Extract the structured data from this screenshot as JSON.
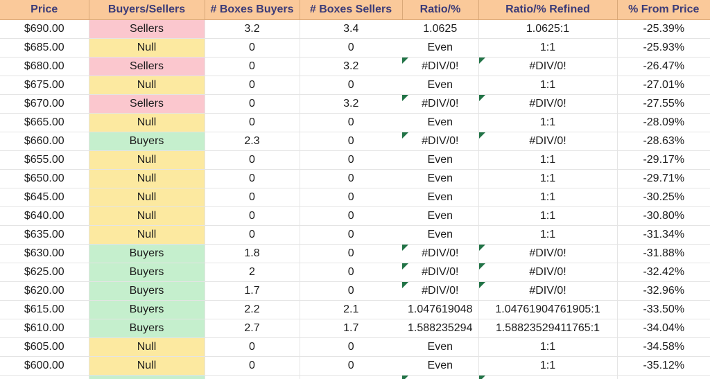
{
  "table": {
    "columns": [
      {
        "key": "price",
        "label": "Price"
      },
      {
        "key": "bs",
        "label": "Buyers/Sellers"
      },
      {
        "key": "boxes_buy",
        "label": "# Boxes Buyers"
      },
      {
        "key": "boxes_sell",
        "label": "# Boxes Sellers"
      },
      {
        "key": "ratio",
        "label": "Ratio/%"
      },
      {
        "key": "ratio_ref",
        "label": "Ratio/% Refined"
      },
      {
        "key": "pct",
        "label": "% From Price"
      }
    ],
    "colors": {
      "header_bg": "#fac99a",
      "header_text": "#3b3b78",
      "sellers_bg": "#fbc7ce",
      "sellers_text": "#cc2f45",
      "null_bg": "#fce9a0",
      "null_text": "#b8860b",
      "buyers_bg": "#c5efcd",
      "buyers_text": "#1b7a32",
      "error_flag": "#217346",
      "gridline": "#e4e4e4",
      "cell_text": "#1d1d1d"
    },
    "rows": [
      {
        "price": "$690.00",
        "bs": "Sellers",
        "status": "sellers",
        "boxes_buy": "3.2",
        "boxes_sell": "3.4",
        "ratio": "1.0625",
        "ratio_flag": false,
        "ratio_ref": "1.0625:1",
        "ratio_ref_flag": false,
        "pct": "-25.39%"
      },
      {
        "price": "$685.00",
        "bs": "Null",
        "status": "null",
        "boxes_buy": "0",
        "boxes_sell": "0",
        "ratio": "Even",
        "ratio_flag": false,
        "ratio_ref": "1:1",
        "ratio_ref_flag": false,
        "pct": "-25.93%"
      },
      {
        "price": "$680.00",
        "bs": "Sellers",
        "status": "sellers",
        "boxes_buy": "0",
        "boxes_sell": "3.2",
        "ratio": "#DIV/0!",
        "ratio_flag": true,
        "ratio_ref": "#DIV/0!",
        "ratio_ref_flag": true,
        "pct": "-26.47%"
      },
      {
        "price": "$675.00",
        "bs": "Null",
        "status": "null",
        "boxes_buy": "0",
        "boxes_sell": "0",
        "ratio": "Even",
        "ratio_flag": false,
        "ratio_ref": "1:1",
        "ratio_ref_flag": false,
        "pct": "-27.01%"
      },
      {
        "price": "$670.00",
        "bs": "Sellers",
        "status": "sellers",
        "boxes_buy": "0",
        "boxes_sell": "3.2",
        "ratio": "#DIV/0!",
        "ratio_flag": true,
        "ratio_ref": "#DIV/0!",
        "ratio_ref_flag": true,
        "pct": "-27.55%"
      },
      {
        "price": "$665.00",
        "bs": "Null",
        "status": "null",
        "boxes_buy": "0",
        "boxes_sell": "0",
        "ratio": "Even",
        "ratio_flag": false,
        "ratio_ref": "1:1",
        "ratio_ref_flag": false,
        "pct": "-28.09%"
      },
      {
        "price": "$660.00",
        "bs": "Buyers",
        "status": "buyers",
        "boxes_buy": "2.3",
        "boxes_sell": "0",
        "ratio": "#DIV/0!",
        "ratio_flag": true,
        "ratio_ref": "#DIV/0!",
        "ratio_ref_flag": true,
        "pct": "-28.63%"
      },
      {
        "price": "$655.00",
        "bs": "Null",
        "status": "null",
        "boxes_buy": "0",
        "boxes_sell": "0",
        "ratio": "Even",
        "ratio_flag": false,
        "ratio_ref": "1:1",
        "ratio_ref_flag": false,
        "pct": "-29.17%"
      },
      {
        "price": "$650.00",
        "bs": "Null",
        "status": "null",
        "boxes_buy": "0",
        "boxes_sell": "0",
        "ratio": "Even",
        "ratio_flag": false,
        "ratio_ref": "1:1",
        "ratio_ref_flag": false,
        "pct": "-29.71%"
      },
      {
        "price": "$645.00",
        "bs": "Null",
        "status": "null",
        "boxes_buy": "0",
        "boxes_sell": "0",
        "ratio": "Even",
        "ratio_flag": false,
        "ratio_ref": "1:1",
        "ratio_ref_flag": false,
        "pct": "-30.25%"
      },
      {
        "price": "$640.00",
        "bs": "Null",
        "status": "null",
        "boxes_buy": "0",
        "boxes_sell": "0",
        "ratio": "Even",
        "ratio_flag": false,
        "ratio_ref": "1:1",
        "ratio_ref_flag": false,
        "pct": "-30.80%"
      },
      {
        "price": "$635.00",
        "bs": "Null",
        "status": "null",
        "boxes_buy": "0",
        "boxes_sell": "0",
        "ratio": "Even",
        "ratio_flag": false,
        "ratio_ref": "1:1",
        "ratio_ref_flag": false,
        "pct": "-31.34%"
      },
      {
        "price": "$630.00",
        "bs": "Buyers",
        "status": "buyers",
        "boxes_buy": "1.8",
        "boxes_sell": "0",
        "ratio": "#DIV/0!",
        "ratio_flag": true,
        "ratio_ref": "#DIV/0!",
        "ratio_ref_flag": true,
        "pct": "-31.88%"
      },
      {
        "price": "$625.00",
        "bs": "Buyers",
        "status": "buyers",
        "boxes_buy": "2",
        "boxes_sell": "0",
        "ratio": "#DIV/0!",
        "ratio_flag": true,
        "ratio_ref": "#DIV/0!",
        "ratio_ref_flag": true,
        "pct": "-32.42%"
      },
      {
        "price": "$620.00",
        "bs": "Buyers",
        "status": "buyers",
        "boxes_buy": "1.7",
        "boxes_sell": "0",
        "ratio": "#DIV/0!",
        "ratio_flag": true,
        "ratio_ref": "#DIV/0!",
        "ratio_ref_flag": true,
        "pct": "-32.96%"
      },
      {
        "price": "$615.00",
        "bs": "Buyers",
        "status": "buyers",
        "boxes_buy": "2.2",
        "boxes_sell": "2.1",
        "ratio": "1.047619048",
        "ratio_flag": false,
        "ratio_ref": "1.04761904761905:1",
        "ratio_ref_flag": false,
        "pct": "-33.50%"
      },
      {
        "price": "$610.00",
        "bs": "Buyers",
        "status": "buyers",
        "boxes_buy": "2.7",
        "boxes_sell": "1.7",
        "ratio": "1.588235294",
        "ratio_flag": false,
        "ratio_ref": "1.58823529411765:1",
        "ratio_ref_flag": false,
        "pct": "-34.04%"
      },
      {
        "price": "$605.00",
        "bs": "Null",
        "status": "null",
        "boxes_buy": "0",
        "boxes_sell": "0",
        "ratio": "Even",
        "ratio_flag": false,
        "ratio_ref": "1:1",
        "ratio_ref_flag": false,
        "pct": "-34.58%"
      },
      {
        "price": "$600.00",
        "bs": "Null",
        "status": "null",
        "boxes_buy": "0",
        "boxes_sell": "0",
        "ratio": "Even",
        "ratio_flag": false,
        "ratio_ref": "1:1",
        "ratio_ref_flag": false,
        "pct": "-35.12%"
      },
      {
        "price": "",
        "bs": "",
        "status": "buyers",
        "boxes_buy": "",
        "boxes_sell": "",
        "ratio": "",
        "ratio_flag": true,
        "ratio_ref": "",
        "ratio_ref_flag": true,
        "pct": "",
        "partial": true
      }
    ]
  }
}
